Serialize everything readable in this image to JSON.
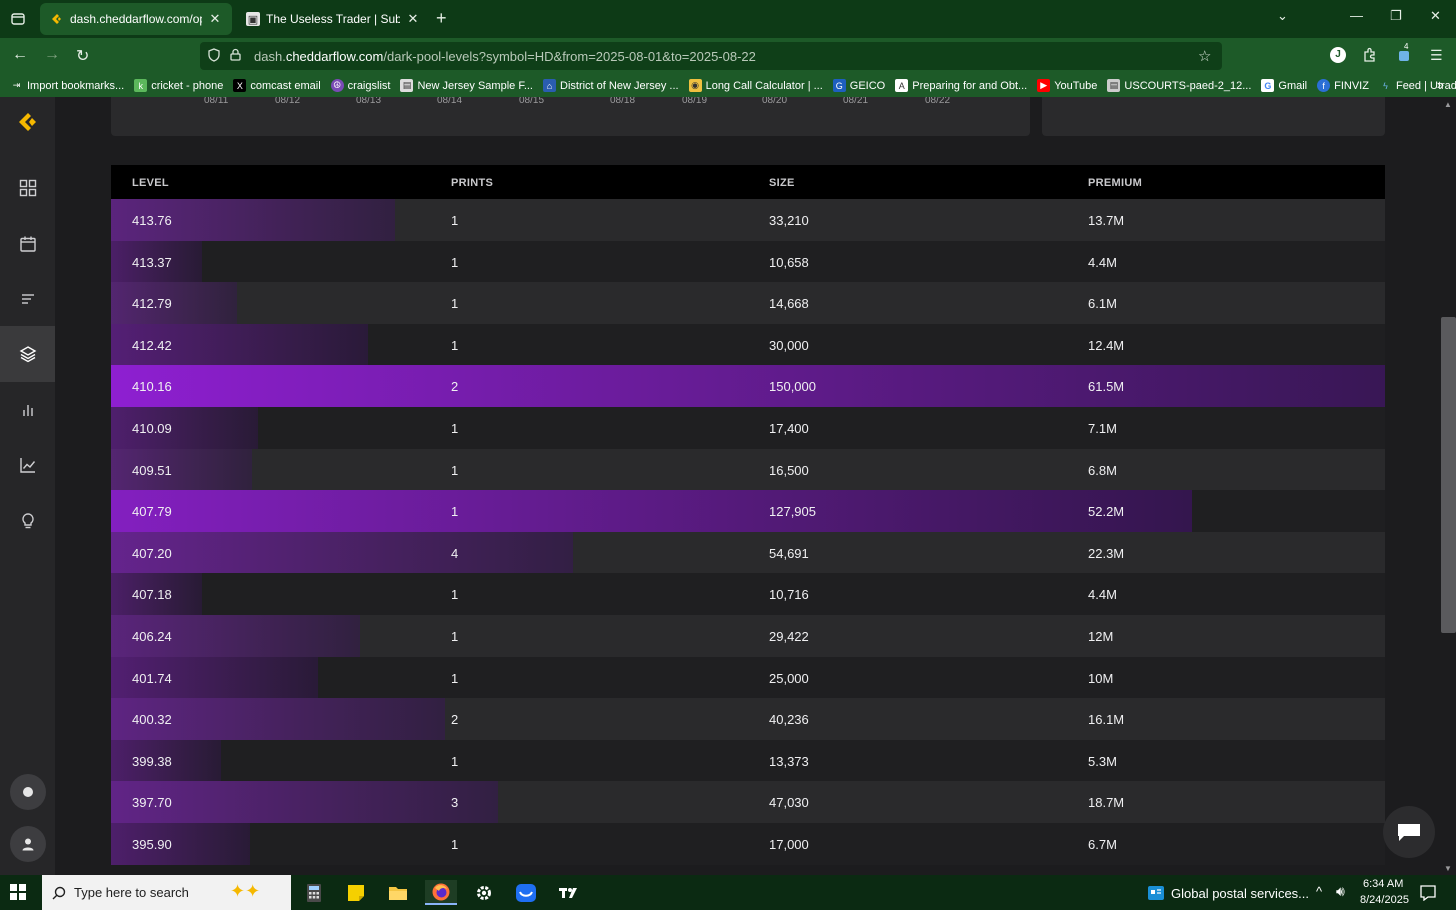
{
  "browser": {
    "tabs": [
      {
        "title": "dash.cheddarflow.com/options",
        "active": true
      },
      {
        "title": "The Useless Trader | Substack",
        "active": false
      }
    ],
    "url_prefix": "dash.",
    "url_domain": "cheddarflow.com",
    "url_path": "/dark-pool-levels?symbol=HD&from=2025-08-01&to=2025-08-22",
    "profile_initial": "J",
    "extension_badge": "4",
    "bookmarks": [
      "Import bookmarks...",
      "cricket - phone",
      "comcast email",
      "craigslist",
      "New Jersey Sample F...",
      "District of New Jersey ...",
      "Long Call Calculator | ...",
      "GEICO",
      "Preparing for and Obt...",
      "YouTube",
      "USCOURTS-paed-2_12...",
      "Gmail",
      "FINVIZ",
      "Feed | Utradea"
    ]
  },
  "chart": {
    "date_ticks": [
      "08/11",
      "08/12",
      "08/13",
      "08/14",
      "08/15",
      "08/18",
      "08/19",
      "08/20",
      "08/21",
      "08/22"
    ]
  },
  "table": {
    "headers": {
      "level": "LEVEL",
      "prints": "PRINTS",
      "size": "SIZE",
      "premium": "PREMIUM"
    },
    "rows": [
      {
        "level": "413.76",
        "prints": "1",
        "size": "33,210",
        "premium": "13.7M",
        "premium_m": 13.7
      },
      {
        "level": "413.37",
        "prints": "1",
        "size": "10,658",
        "premium": "4.4M",
        "premium_m": 4.4
      },
      {
        "level": "412.79",
        "prints": "1",
        "size": "14,668",
        "premium": "6.1M",
        "premium_m": 6.1
      },
      {
        "level": "412.42",
        "prints": "1",
        "size": "30,000",
        "premium": "12.4M",
        "premium_m": 12.4
      },
      {
        "level": "410.16",
        "prints": "2",
        "size": "150,000",
        "premium": "61.5M",
        "premium_m": 61.5
      },
      {
        "level": "410.09",
        "prints": "1",
        "size": "17,400",
        "premium": "7.1M",
        "premium_m": 7.1
      },
      {
        "level": "409.51",
        "prints": "1",
        "size": "16,500",
        "premium": "6.8M",
        "premium_m": 6.8
      },
      {
        "level": "407.79",
        "prints": "1",
        "size": "127,905",
        "premium": "52.2M",
        "premium_m": 52.2
      },
      {
        "level": "407.20",
        "prints": "4",
        "size": "54,691",
        "premium": "22.3M",
        "premium_m": 22.3
      },
      {
        "level": "407.18",
        "prints": "1",
        "size": "10,716",
        "premium": "4.4M",
        "premium_m": 4.4
      },
      {
        "level": "406.24",
        "prints": "1",
        "size": "29,422",
        "premium": "12M",
        "premium_m": 12
      },
      {
        "level": "401.74",
        "prints": "1",
        "size": "25,000",
        "premium": "10M",
        "premium_m": 10
      },
      {
        "level": "400.32",
        "prints": "2",
        "size": "40,236",
        "premium": "16.1M",
        "premium_m": 16.1
      },
      {
        "level": "399.38",
        "prints": "1",
        "size": "13,373",
        "premium": "5.3M",
        "premium_m": 5.3
      },
      {
        "level": "397.70",
        "prints": "3",
        "size": "47,030",
        "premium": "18.7M",
        "premium_m": 18.7
      },
      {
        "level": "395.90",
        "prints": "1",
        "size": "17,000",
        "premium": "6.7M",
        "premium_m": 6.7
      }
    ],
    "max_premium_m": 61.5
  },
  "colors": {
    "accent": "#f5b800",
    "bar_bright": "#8e1fd1",
    "bar_dark": "#2d1b3d"
  },
  "taskbar": {
    "search_placeholder": "Type here to search",
    "news_text": "Global postal services...",
    "time": "6:34 AM",
    "date": "8/24/2025"
  }
}
